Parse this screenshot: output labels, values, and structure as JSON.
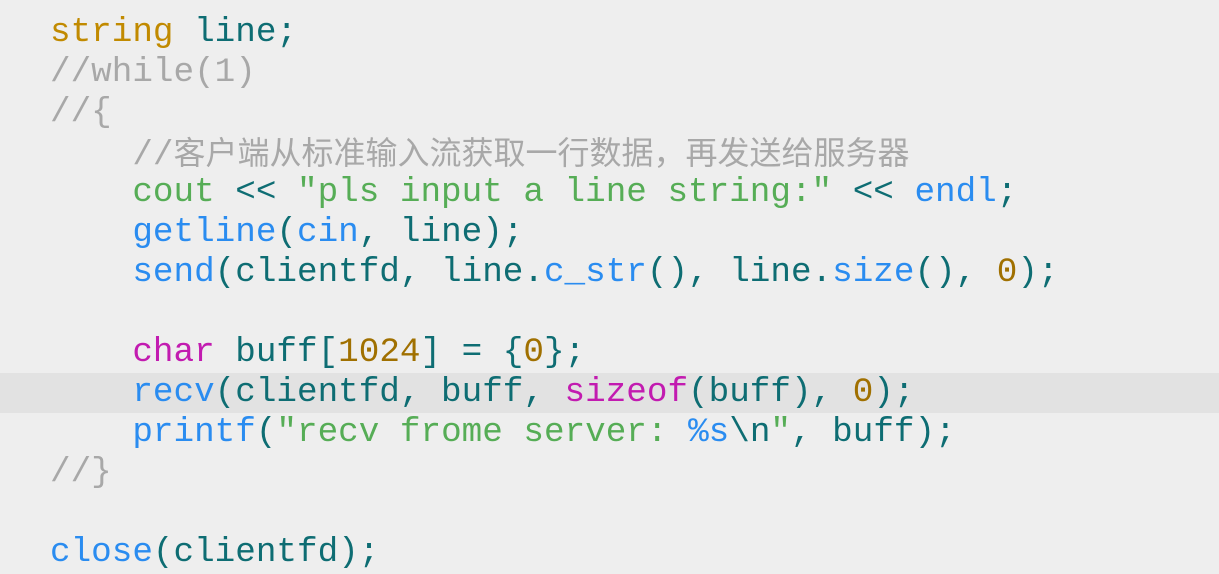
{
  "highlighted_line": 9,
  "colors": {
    "type": "#c18a00",
    "identifier": "#0e6d73",
    "comment": "#a8a8a8",
    "string": "#56ad56",
    "function": "#2a8cf0",
    "keyword": "#c21bb0",
    "number": "#a07000",
    "highlight": "#e2e2e2"
  },
  "lines": [
    [
      [
        "string",
        "type"
      ],
      [
        " line;",
        "id"
      ]
    ],
    [
      [
        "//while(1)",
        "cm"
      ]
    ],
    [
      [
        "//{",
        "cm"
      ]
    ],
    [
      [
        "    //",
        "cm"
      ],
      [
        "客户端从标准输入流获取一行数据，再发送给服务器",
        "cjk"
      ]
    ],
    [
      [
        "    ",
        "id"
      ],
      [
        "cout",
        "str"
      ],
      [
        " << ",
        "id"
      ],
      [
        "\"pls input a line string:\"",
        "str"
      ],
      [
        " << ",
        "id"
      ],
      [
        "endl",
        "fn"
      ],
      [
        ";",
        "id"
      ]
    ],
    [
      [
        "    ",
        "id"
      ],
      [
        "getline",
        "fn"
      ],
      [
        "(",
        "id"
      ],
      [
        "cin",
        "fn"
      ],
      [
        ", line);",
        "id"
      ]
    ],
    [
      [
        "    ",
        "id"
      ],
      [
        "send",
        "fn"
      ],
      [
        "(clientfd, line.",
        "id"
      ],
      [
        "c_str",
        "fn"
      ],
      [
        "(), line.",
        "id"
      ],
      [
        "size",
        "fn"
      ],
      [
        "(), ",
        "id"
      ],
      [
        "0",
        "num"
      ],
      [
        ");",
        "id"
      ]
    ],
    [],
    [
      [
        "    ",
        "id"
      ],
      [
        "char",
        "kw"
      ],
      [
        " buff[",
        "id"
      ],
      [
        "1024",
        "num"
      ],
      [
        "] = {",
        "id"
      ],
      [
        "0",
        "num"
      ],
      [
        "};",
        "id"
      ]
    ],
    [
      [
        "    ",
        "id"
      ],
      [
        "recv",
        "fn"
      ],
      [
        "(clientfd, buff, ",
        "id"
      ],
      [
        "sizeof",
        "kw"
      ],
      [
        "(buff), ",
        "id"
      ],
      [
        "0",
        "num"
      ],
      [
        ");",
        "id"
      ]
    ],
    [
      [
        "    ",
        "id"
      ],
      [
        "printf",
        "fn"
      ],
      [
        "(",
        "id"
      ],
      [
        "\"recv frome server: ",
        "str"
      ],
      [
        "%s",
        "fn"
      ],
      [
        "\\n",
        "id"
      ],
      [
        "\"",
        "str"
      ],
      [
        ", buff);",
        "id"
      ]
    ],
    [
      [
        "//}",
        "cm"
      ]
    ],
    [],
    [
      [
        "close",
        "fn"
      ],
      [
        "(clientfd);",
        "id"
      ]
    ]
  ]
}
